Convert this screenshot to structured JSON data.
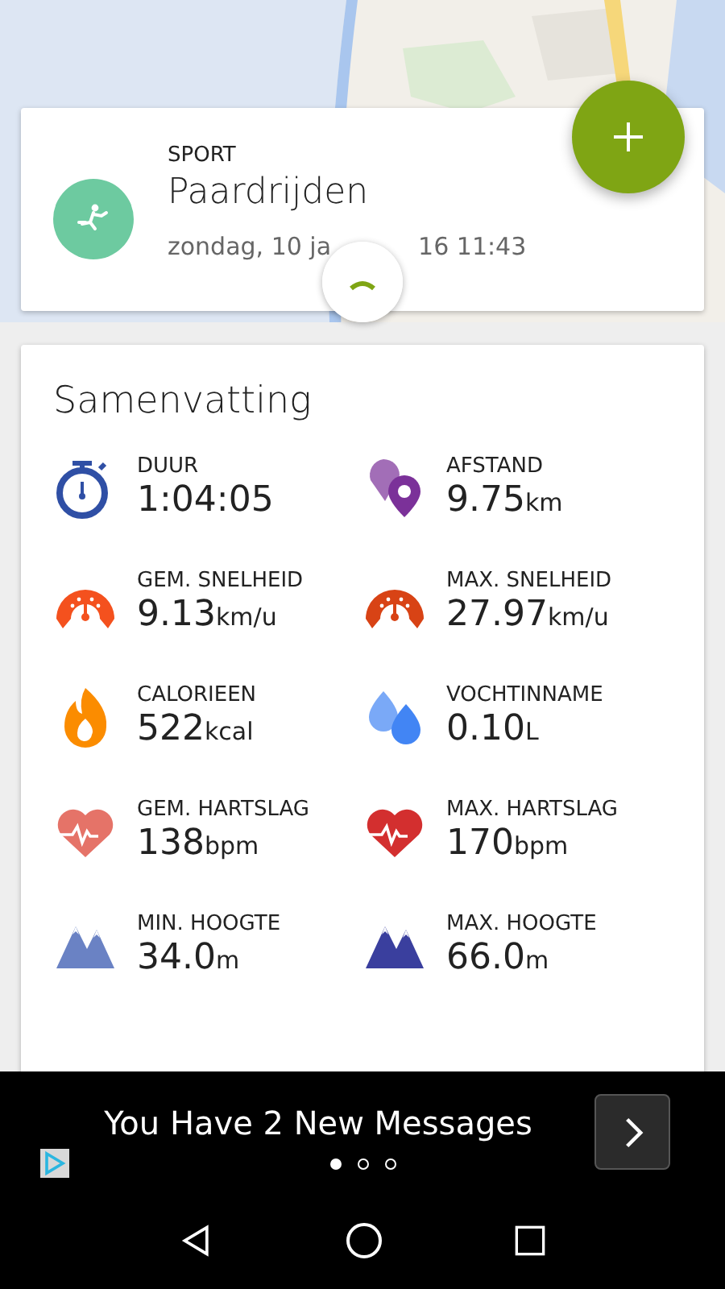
{
  "activity": {
    "label": "SPORT",
    "name": "Paardrijden",
    "date_before": "zondag, 10 ja",
    "date_after": "16 11:43"
  },
  "summary": {
    "title": "Samenvatting",
    "stats": [
      {
        "kind": "stopwatch",
        "color": "#2f4fa5",
        "label": "DUUR",
        "value": "1:04:05"
      },
      {
        "kind": "pins",
        "color": "#7b3199",
        "label": "AFSTAND",
        "value": "9.75",
        "unit": "km"
      },
      {
        "kind": "gauge",
        "color": "#f4511e",
        "label": "GEM. SNELHEID",
        "value": "9.13",
        "unit": "km/u"
      },
      {
        "kind": "gauge",
        "color": "#d84315",
        "label": "MAX. SNELHEID",
        "value": "27.97",
        "unit": "km/u"
      },
      {
        "kind": "flame",
        "color": "#fb8c00",
        "label": "CALORIEEN",
        "value": "522",
        "unit": "kcal"
      },
      {
        "kind": "drops",
        "color": "#4285f4",
        "label": "VOCHTINNAME",
        "value": "0.10",
        "unit": "L"
      },
      {
        "kind": "heart",
        "color": "#e57368",
        "label": "GEM. HARTSLAG",
        "value": "138",
        "unit": "bpm"
      },
      {
        "kind": "heart",
        "color": "#d32f2f",
        "label": "MAX. HARTSLAG",
        "value": "170",
        "unit": "bpm"
      },
      {
        "kind": "mountains",
        "color": "#6a82c4",
        "label": "MIN. HOOGTE",
        "value": "34.0",
        "unit": "m"
      },
      {
        "kind": "mountains",
        "color": "#3a3f9e",
        "label": "MAX. HOOGTE",
        "value": "66.0",
        "unit": "m"
      }
    ]
  },
  "ad": {
    "text": "You Have 2 New Messages",
    "pages": [
      {
        "selected": true
      },
      {
        "selected": false
      },
      {
        "selected": false
      }
    ]
  }
}
